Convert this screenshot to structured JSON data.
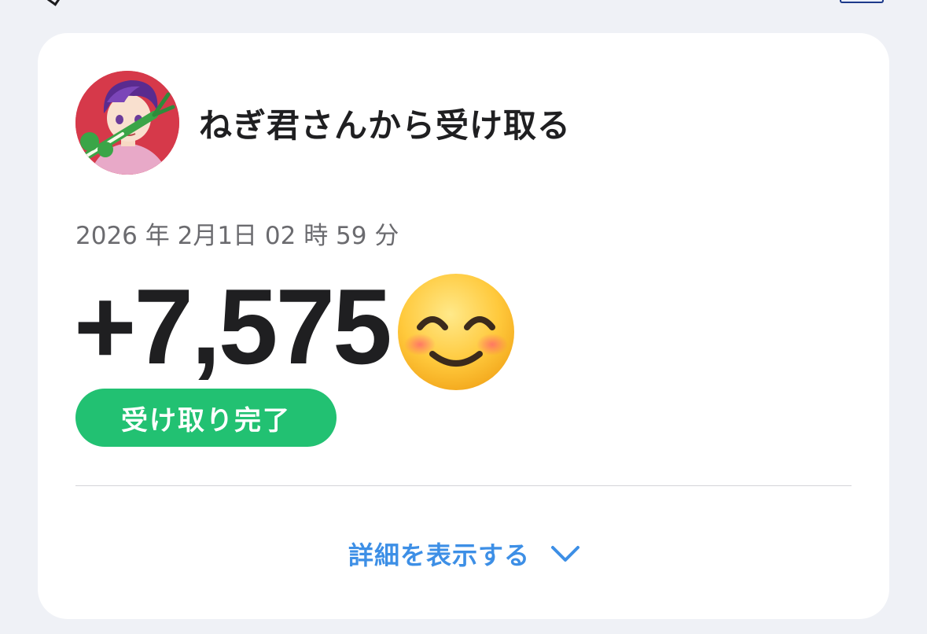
{
  "card": {
    "sender_title": "ねぎ君さんから受け取る",
    "datetime": "2026 年 2月1日 02 時 59 分",
    "amount": "+7,575",
    "emoji_icon": "smiling-face-with-smiling-eyes",
    "status_label": "受け取り完了",
    "detail_label": "詳細を表示する",
    "detail_icon": "chevron-down"
  },
  "colors": {
    "background": "#eff1f6",
    "card": "#ffffff",
    "status_green": "#22c172",
    "link_blue": "#3d8fe6",
    "text_dark": "#1f1f21",
    "text_gray": "#6b6b6f"
  }
}
